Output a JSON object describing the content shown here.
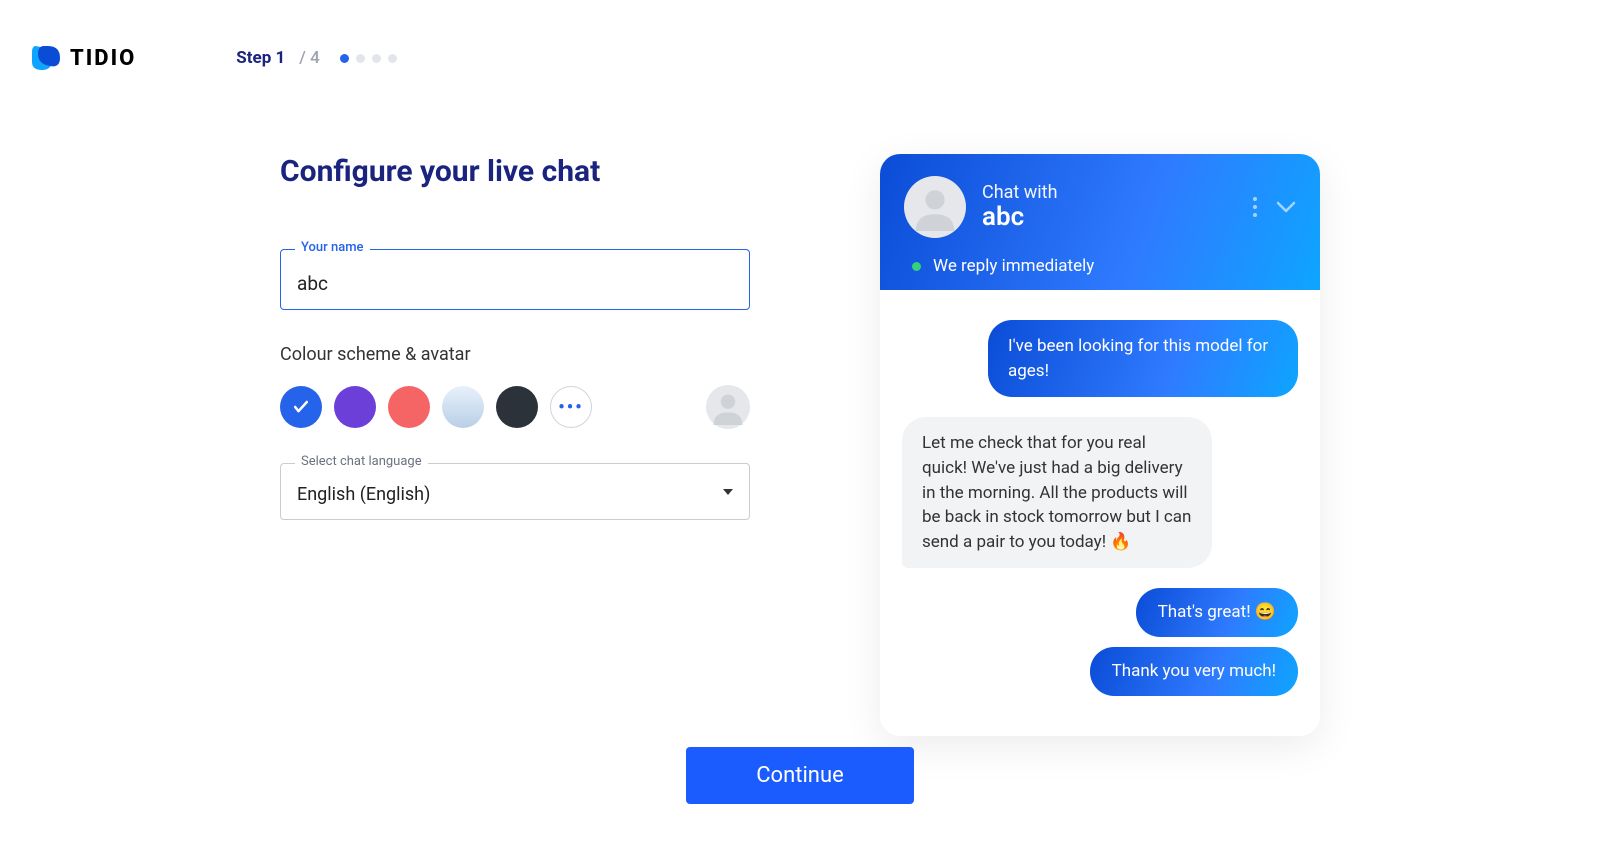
{
  "brand": {
    "name": "TIDIO"
  },
  "stepper": {
    "current_label": "Step 1",
    "total_label": "/ 4",
    "current": 1,
    "total": 4
  },
  "page": {
    "title": "Configure your live chat"
  },
  "form": {
    "name_label": "Your name",
    "name_value": "abc",
    "colour_label": "Colour scheme & avatar",
    "swatches": [
      {
        "id": "blue",
        "color": "#2563eb",
        "selected": true
      },
      {
        "id": "purple",
        "color": "#6b3fd8",
        "selected": false
      },
      {
        "id": "coral",
        "color": "#f56565",
        "selected": false
      },
      {
        "id": "lightblue",
        "color": "#cfe3f5",
        "selected": false
      },
      {
        "id": "dark",
        "color": "#2b323a",
        "selected": false
      }
    ],
    "more_label": "•••",
    "language_label": "Select chat language",
    "language_value": "English (English)"
  },
  "preview": {
    "chat_with": "Chat with",
    "chat_name": "abc",
    "reply_text": "We reply immediately",
    "messages": [
      {
        "who": "user",
        "text": "I've been looking for this model for ages!"
      },
      {
        "who": "agent",
        "text": "Let me check that for you real quick! We've just had a big delivery in the morning. All the products will be back in stock tomorrow but I can send a pair to you today! 🔥"
      },
      {
        "who": "user",
        "text": "That's great! 😄"
      },
      {
        "who": "user",
        "text": "Thank you very much!"
      }
    ]
  },
  "footer": {
    "continue_label": "Continue"
  }
}
